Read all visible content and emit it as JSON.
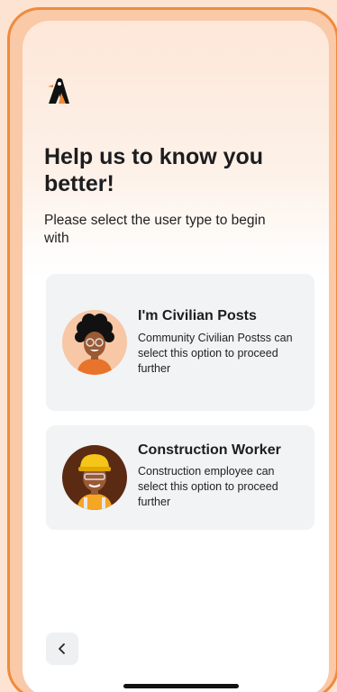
{
  "header": {
    "logo_icon": "penguin-logo-icon",
    "title": "Help us to know you better!",
    "subtitle": "Please select the user type to begin with"
  },
  "options": [
    {
      "title": "I'm Civilian Posts",
      "description": "Community Civilian Postss can select this option to proceed further",
      "icon": "civilian-avatar-icon"
    },
    {
      "title": "Construction Worker",
      "description": "Construction employee can select this option to proceed further",
      "icon": "construction-worker-avatar-icon"
    }
  ],
  "navigation": {
    "back_icon": "chevron-left-icon"
  },
  "colors": {
    "accent": "#f08a3a",
    "card_background": "#f1f3f4",
    "text": "#1d1d1f"
  }
}
